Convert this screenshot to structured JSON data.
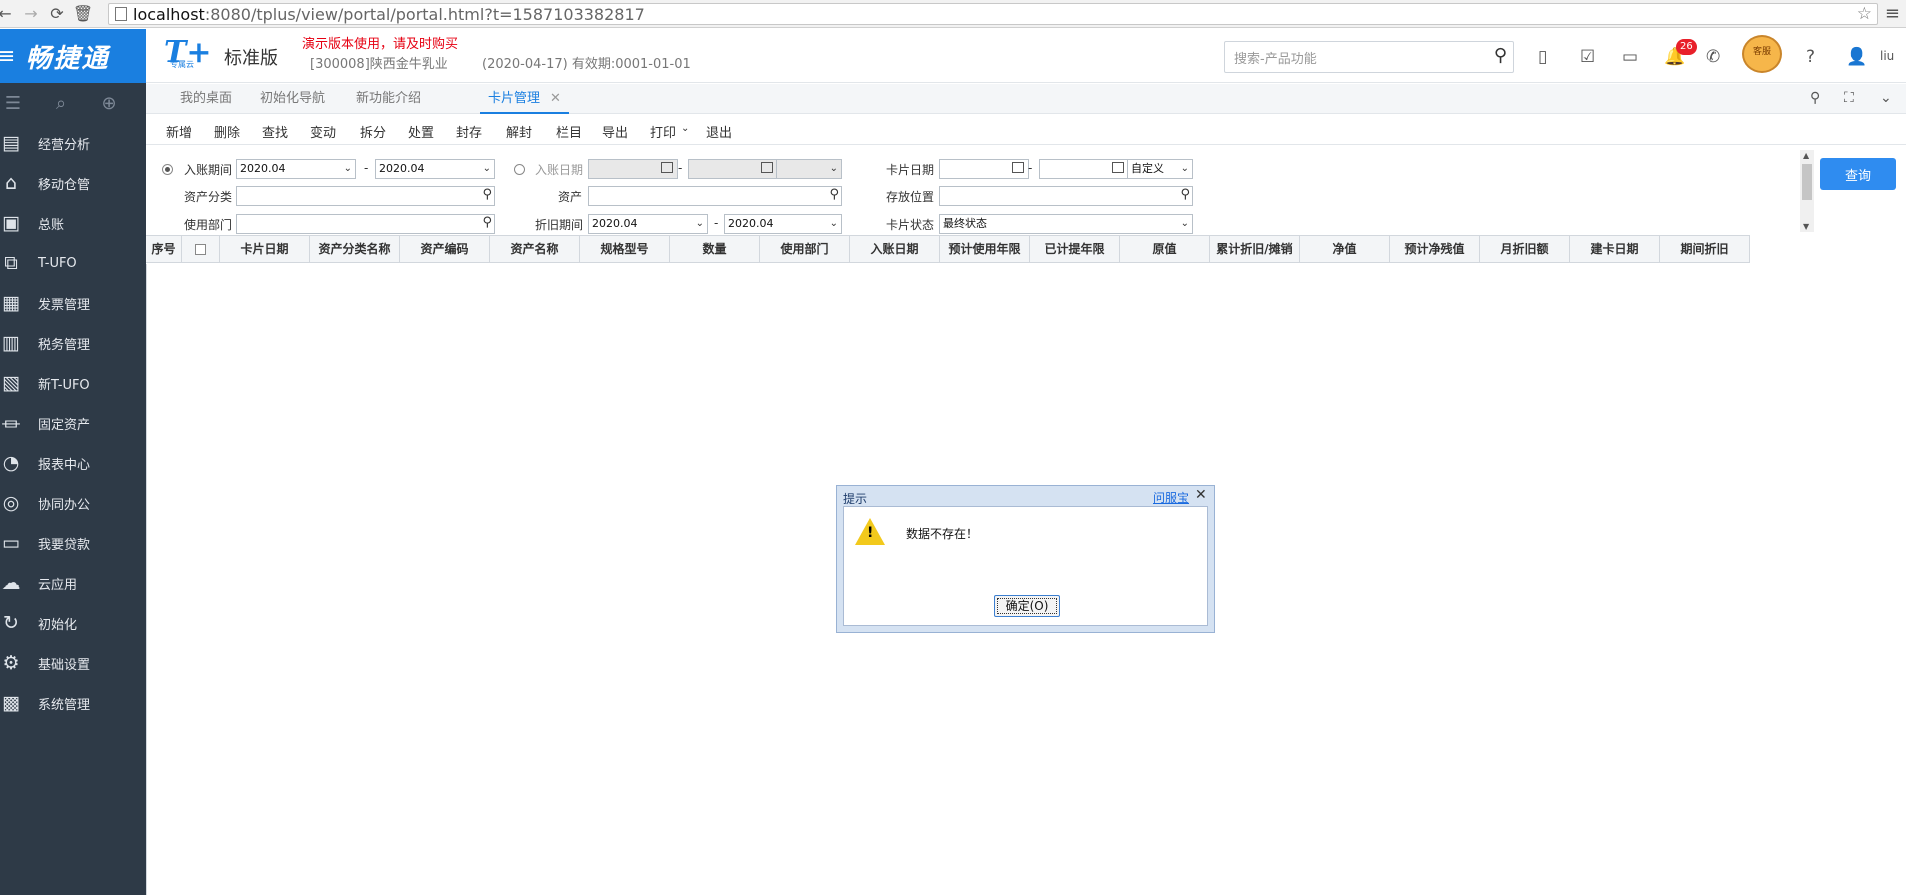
{
  "browser": {
    "url_host": "localhost",
    "url_rest": ":8080/tplus/view/portal/portal.html?t=1587103382817"
  },
  "sidebar": {
    "brand": "畅捷通",
    "items": [
      {
        "label": "经营分析",
        "icon": "chart-board-icon"
      },
      {
        "label": "移动仓管",
        "icon": "warehouse-icon"
      },
      {
        "label": "总账",
        "icon": "ledger-icon"
      },
      {
        "label": "T-UFO",
        "icon": "ufo-icon"
      },
      {
        "label": "发票管理",
        "icon": "invoice-icon"
      },
      {
        "label": "税务管理",
        "icon": "tax-icon"
      },
      {
        "label": "新T-UFO",
        "icon": "new-ufo-icon"
      },
      {
        "label": "固定资产",
        "icon": "bank-building-icon"
      },
      {
        "label": "报表中心",
        "icon": "pie-chart-icon"
      },
      {
        "label": "协同办公",
        "icon": "collaboration-icon"
      },
      {
        "label": "我要贷款",
        "icon": "money-icon"
      },
      {
        "label": "云应用",
        "icon": "cloud-icon"
      },
      {
        "label": "初始化",
        "icon": "refresh-icon"
      },
      {
        "label": "基础设置",
        "icon": "settings-icon"
      },
      {
        "label": "系统管理",
        "icon": "system-icon"
      }
    ]
  },
  "header": {
    "edition": "标准版",
    "logo_sub": "专属云",
    "demo_warning": "演示版本使用，请及时购买",
    "company": "[300008]陕西金牛乳业",
    "validity": "(2020-04-17)   有效期:0001-01-01",
    "search_placeholder": "搜索-产品功能",
    "notification_count": "26",
    "service_label": "客服",
    "user": "liu"
  },
  "tabs": [
    {
      "label": "我的桌面"
    },
    {
      "label": "初始化导航"
    },
    {
      "label": "新功能介绍"
    },
    {
      "label": "卡片管理",
      "active": true
    }
  ],
  "toolbar": [
    "新增",
    "删除",
    "查找",
    "变动",
    "拆分",
    "处置",
    "封存",
    "解封",
    "栏目",
    "导出",
    "打印",
    "退出"
  ],
  "filter": {
    "entry_period_label": "入账期间",
    "entry_period_from": "2020.04",
    "entry_period_to": "2020.04",
    "entry_date_label": "入账日期",
    "card_date_label": "卡片日期",
    "card_date_mode": "自定义",
    "asset_category_label": "资产分类",
    "asset_label": "资产",
    "location_label": "存放位置",
    "department_label": "使用部门",
    "depreciation_period_label": "折旧期间",
    "depreciation_from": "2020.04",
    "depreciation_to": "2020.04",
    "card_status_label": "卡片状态",
    "card_status_value": "最终状态",
    "query_label": "查询",
    "dash": "-"
  },
  "grid": {
    "columns": [
      "序号",
      "",
      "卡片日期",
      "资产分类名称",
      "资产编码",
      "资产名称",
      "规格型号",
      "数量",
      "使用部门",
      "入账日期",
      "预计使用年限",
      "已计提年限",
      "原值",
      "累计折旧/摊销",
      "净值",
      "预计净残值",
      "月折旧额",
      "建卡日期",
      "期间折旧"
    ]
  },
  "dialog": {
    "title": "提示",
    "help": "问服宝",
    "message": "数据不存在！",
    "ok_label": "确定(O)"
  }
}
